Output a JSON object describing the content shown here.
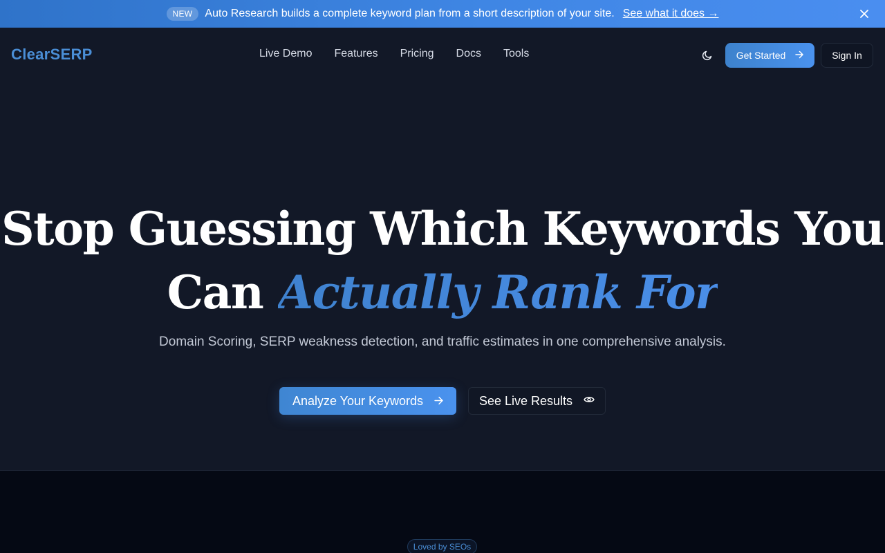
{
  "announcement": {
    "badge": "NEW",
    "message": "Auto Research builds a complete keyword plan from a short description of your site.",
    "link": "See what it does →",
    "close_icon": "close-icon"
  },
  "nav": {
    "logo": "ClearSERP",
    "items": [
      {
        "label": "Live Demo"
      },
      {
        "label": "Features"
      },
      {
        "label": "Pricing"
      },
      {
        "label": "Docs"
      },
      {
        "label": "Tools"
      }
    ],
    "theme_icon": "moon-icon",
    "get_started": "Get Started",
    "sign_in": "Sign In"
  },
  "hero": {
    "headline_part1": "Stop Guessing Which Keywords You",
    "headline_part2": "Can",
    "headline_accent": "Actually Rank For",
    "subheadline": "Domain Scoring, SERP weakness detection, and traffic estimates in one comprehensive analysis.",
    "primary_cta": "Analyze Your Keywords",
    "secondary_cta": "See Live Results"
  },
  "social_proof": {
    "badge": "Loved by SEOs"
  },
  "colors": {
    "background": "#121827",
    "accent": "#4a8ed6",
    "banner": "#3f86e4",
    "lower_background": "#050914"
  }
}
